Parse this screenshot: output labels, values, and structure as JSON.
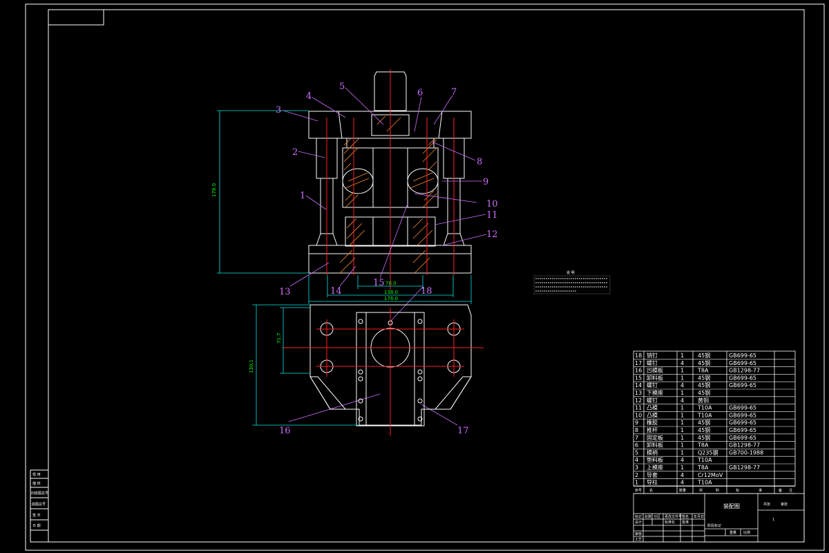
{
  "colors": {
    "outline": "#ffffff",
    "centerline": "#ff2020",
    "dimension": "#00e8e8",
    "dimension_text": "#00ff00",
    "balloon": "#d070ff",
    "hatch": "#ff8a2a",
    "background": "#000000"
  },
  "callouts": [
    "1",
    "2",
    "3",
    "4",
    "5",
    "6",
    "7",
    "8",
    "9",
    "10",
    "11",
    "12",
    "13",
    "14",
    "15",
    "16",
    "17",
    "18"
  ],
  "dimensions": {
    "height": "178.0",
    "inner_width": "70.0",
    "middle_width": "138.0",
    "outer_width": "178.0",
    "plan_height": "130.1",
    "plan_half": "71.7"
  },
  "notes_title": "说 明",
  "bom": {
    "rows": [
      {
        "no": "18",
        "name": "销钉",
        "qty": "1",
        "material": "45钢",
        "std": "GB699-65"
      },
      {
        "no": "17",
        "name": "螺钉",
        "qty": "4",
        "material": "45钢",
        "std": "GB699-65"
      },
      {
        "no": "16",
        "name": "凹模板",
        "qty": "1",
        "material": "T8A",
        "std": "GB1298-77"
      },
      {
        "no": "15",
        "name": "卸料板",
        "qty": "1",
        "material": "45钢",
        "std": "GB699-65"
      },
      {
        "no": "14",
        "name": "螺钉",
        "qty": "4",
        "material": "45钢",
        "std": "GB699-65"
      },
      {
        "no": "13",
        "name": "下模座",
        "qty": "1",
        "material": "45钢",
        "std": ""
      },
      {
        "no": "12",
        "name": "螺钉",
        "qty": "4",
        "material": "黄铜",
        "std": ""
      },
      {
        "no": "11",
        "name": "凸模",
        "qty": "1",
        "material": "T10A",
        "std": "GB699-65"
      },
      {
        "no": "10",
        "name": "凸模",
        "qty": "1",
        "material": "T10A",
        "std": "GB699-65"
      },
      {
        "no": "9",
        "name": "橡胶",
        "qty": "1",
        "material": "45钢",
        "std": "GB699-65"
      },
      {
        "no": "8",
        "name": "推杆",
        "qty": "1",
        "material": "45钢",
        "std": "GB699-65"
      },
      {
        "no": "7",
        "name": "固定板",
        "qty": "1",
        "material": "45钢",
        "std": "GB699-65"
      },
      {
        "no": "6",
        "name": "卸料板",
        "qty": "1",
        "material": "T8A",
        "std": "GB1298-77"
      },
      {
        "no": "5",
        "name": "模柄",
        "qty": "1",
        "material": "Q235钢",
        "std": "GB700-1988"
      },
      {
        "no": "4",
        "name": "垫料板",
        "qty": "4",
        "material": "T10A",
        "std": ""
      },
      {
        "no": "3",
        "name": "上模座",
        "qty": "1",
        "material": "T8A",
        "std": "GB1298-77"
      },
      {
        "no": "2",
        "name": "导套",
        "qty": "4",
        "material": "Cr12MoV",
        "std": ""
      },
      {
        "no": "1",
        "name": "导柱",
        "qty": "4",
        "material": "T10A",
        "std": ""
      }
    ],
    "header": [
      "序号",
      "名",
      "数量",
      "材",
      "料",
      "标",
      "准",
      "备",
      "注"
    ]
  },
  "title_block": {
    "drawing_name": "装配图",
    "cells_left": [
      "标记",
      "处数",
      "分区",
      "更改文件号",
      "签名",
      "年月日",
      "设计",
      "标准化",
      "审核",
      "工艺",
      "批准"
    ],
    "cells_right": [
      "阶段标记",
      "重量",
      "比例",
      "共张",
      "第张"
    ],
    "sheet_no": "1"
  },
  "side_stamp": [
    "借 用",
    "描 校",
    "旧底图总号",
    "底图总号",
    "签 字",
    "日 期"
  ]
}
